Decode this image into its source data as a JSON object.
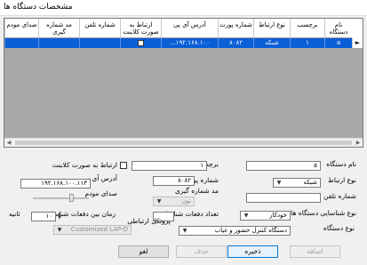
{
  "window": {
    "title": "مشخصات دستگاه ها",
    "minimize_icon": "minimize-icon",
    "maximize_icon": "maximize-icon",
    "close_icon": "close-icon"
  },
  "grid": {
    "columns": [
      "نام دستگاه",
      "برچسب",
      "نوع ارتباط",
      "شماره پورت",
      "آدرس آی پی",
      "ارتباط به صورت کلاینت",
      "شماره تلفن",
      "مد شماره گیری",
      "صدای مودم"
    ],
    "row": {
      "name": "a",
      "label": "۱",
      "connection_type": "شبکه",
      "port": "۸۰۸۲",
      "ip": "...۱۹۲.۱۶۸.۱۰۰",
      "client_connection": false,
      "phone": "",
      "dial_mode": "",
      "modem_sound": ""
    },
    "row_selector": "►"
  },
  "form": {
    "device_name_label": "نام دستگاه",
    "device_name_value": "a",
    "label_label": "برچسب",
    "label_value": "۱",
    "client_label": "ارتباط به صورت کلاینت",
    "client_checked": false,
    "connection_type_label": "نوع ارتباط",
    "connection_type_value": "شبکه",
    "port_label": "شماره پورت",
    "port_value": "۸۰۸۲",
    "ip_label": "آدرس آی پی",
    "ip_value": "۱۹۲.۱۶۸.۱۰۰.۱۱۳",
    "phone_label": "شماره تلفن",
    "phone_value": "",
    "dial_mode_label": "مد شماره گیری",
    "dial_mode_value": "تون",
    "modem_sound_label": "صدای مودم",
    "modem_sound_level": 0.3,
    "device_id_type_label": "نوع شناسایی دستگاه ها",
    "device_id_type_value": "خودکار",
    "id_attempts_label": "تعداد دفعات شناسایی",
    "id_attempts_value": "",
    "id_interval_label": "زمان بین دفعات شناسایی",
    "id_interval_value": "۱۰",
    "id_interval_unit": "ثانیه",
    "device_type_label": "نوع دستگاه",
    "device_type_value": "دستگاه کنترل حضور و غیاب",
    "protocol_label": "پروتکل ارتباطی",
    "protocol_value": "Customized LAP-D",
    "dropdown_icon": "chevron-down-icon",
    "spinner_icon": "spinner-arrows-icon"
  },
  "buttons": {
    "new": "اضافه",
    "save": "ذخیره",
    "delete": "حذف",
    "cancel": "لغو"
  }
}
